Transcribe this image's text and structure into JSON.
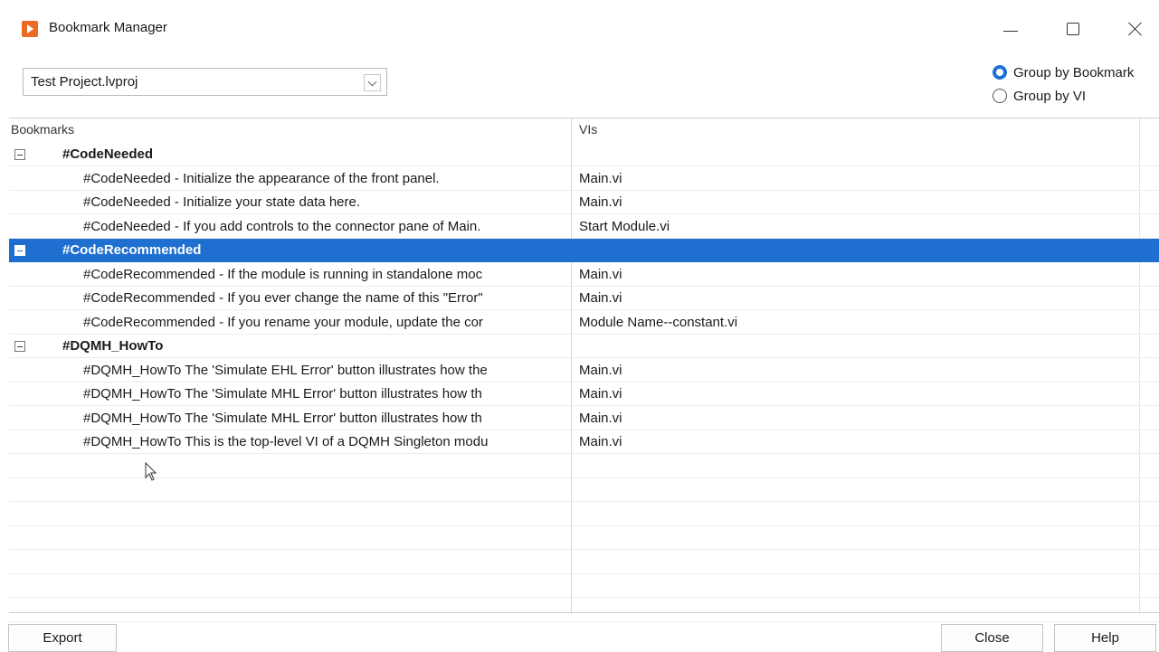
{
  "window": {
    "title": "Bookmark Manager"
  },
  "project_selector": {
    "value": "Test Project.lvproj"
  },
  "grouping": {
    "by_bookmark": "Group by Bookmark",
    "by_vi": "Group by VI",
    "selected": "by_bookmark"
  },
  "table": {
    "headers": {
      "bookmarks": "Bookmarks",
      "vis": "VIs"
    },
    "rows": [
      {
        "type": "group",
        "bookmark": "#CodeNeeded",
        "vi": ""
      },
      {
        "type": "item",
        "bookmark": "#CodeNeeded - Initialize the appearance of the front panel.",
        "vi": "Main.vi"
      },
      {
        "type": "item",
        "bookmark": "#CodeNeeded - Initialize your state data here.",
        "vi": "Main.vi"
      },
      {
        "type": "item",
        "bookmark": "#CodeNeeded - If you add controls to the connector pane of Main.",
        "vi": "Start Module.vi"
      },
      {
        "type": "group",
        "bookmark": "#CodeRecommended",
        "vi": "",
        "selected": true
      },
      {
        "type": "item",
        "bookmark": "#CodeRecommended - If the module is running in standalone moc",
        "vi": "Main.vi"
      },
      {
        "type": "item",
        "bookmark": "#CodeRecommended - If you ever change the name of this \"Error\"",
        "vi": "Main.vi"
      },
      {
        "type": "item",
        "bookmark": "#CodeRecommended - If you rename your module, update the cor",
        "vi": "Module Name--constant.vi"
      },
      {
        "type": "group",
        "bookmark": "#DQMH_HowTo",
        "vi": ""
      },
      {
        "type": "item",
        "bookmark": "#DQMH_HowTo The 'Simulate EHL Error' button  illustrates how the",
        "vi": "Main.vi"
      },
      {
        "type": "item",
        "bookmark": "#DQMH_HowTo The 'Simulate MHL Error' button  illustrates how th",
        "vi": "Main.vi"
      },
      {
        "type": "item",
        "bookmark": "#DQMH_HowTo The 'Simulate MHL Error' button  illustrates how th",
        "vi": "Main.vi"
      },
      {
        "type": "item",
        "bookmark": "#DQMH_HowTo This is the top-level VI of a DQMH Singleton modu",
        "vi": "Main.vi"
      }
    ]
  },
  "buttons": {
    "export": "Export",
    "close": "Close",
    "help": "Help"
  },
  "colors": {
    "selection": "#1f6fd0",
    "app_icon": "#ec6b24"
  },
  "icons": {
    "app": "labview-app-icon",
    "minimize": "minimize-icon",
    "maximize": "maximize-icon",
    "close": "close-icon",
    "expander": "collapse-icon",
    "dropdown": "chevron-down-icon"
  }
}
